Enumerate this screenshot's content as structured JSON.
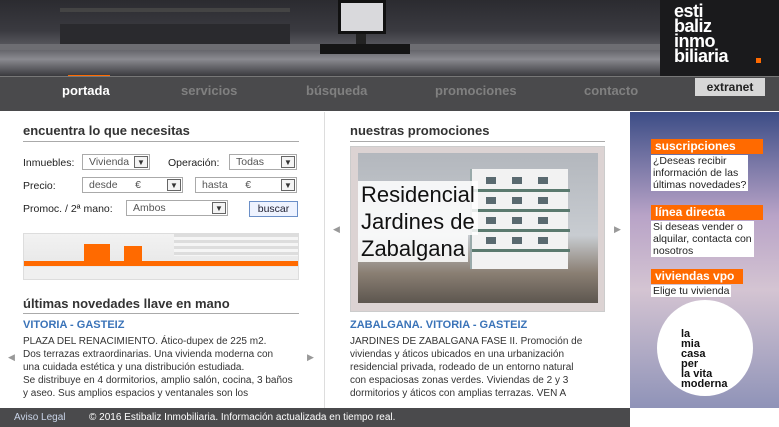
{
  "brand": {
    "lines": [
      "esti",
      "baliz",
      "inmo",
      "biliaria"
    ]
  },
  "nav": {
    "items": [
      {
        "label": "portada"
      },
      {
        "label": "servicios"
      },
      {
        "label": "búsqueda"
      },
      {
        "label": "promociones"
      },
      {
        "label": "contacto"
      }
    ],
    "extranet": "extranet"
  },
  "search": {
    "title": "encuentra lo que necesitas",
    "inmuebles_label": "Inmuebles:",
    "inmuebles_value": "Vivienda",
    "operacion_label": "Operación:",
    "operacion_value": "Todas",
    "precio_label": "Precio:",
    "desde_value": "desde      €",
    "hasta_value": "hasta      €",
    "promoc_label": "Promoc. / 2ª mano:",
    "promoc_value": "Ambos",
    "buscar_label": "buscar"
  },
  "novedades": {
    "title": "últimas novedades llave en mano",
    "city": "VITORIA - GASTEIZ",
    "text_lines": [
      "PLAZA DEL RENACIMIENTO. Ático-dupex de 225 m2.",
      "Dos terrazas extraordinarias. Una vivienda moderna con",
      "una cuidada estética y una distribución estudiada.",
      "Se distribuye en 4 dormitorios, amplio salón, cocina, 3 baños",
      "y aseo. Sus amplios espacios y ventanales son los"
    ]
  },
  "promociones": {
    "title": "nuestras promociones",
    "image_text": [
      "Residencial",
      "Jardines de",
      "Zabalgana"
    ],
    "city": "ZABALGANA. VITORIA - GASTEIZ",
    "text_lines": [
      "JARDINES DE ZABALGANA FASE II. Promoción de",
      "viviendas y áticos ubicados en una urbanización",
      "residencial privada, rodeado de un entorno natural",
      "con espaciosas zonas verdes. Viviendas de 2 y 3",
      "dormitorios y áticos  con amplias terrazas. VEN A"
    ]
  },
  "sidebar": {
    "suscripciones": {
      "title": "suscripciones",
      "lines": [
        "¿Deseas recibir",
        "información de las",
        "últimas novedades?"
      ]
    },
    "linea": {
      "title": "línea directa",
      "lines": [
        "Si deseas vender o",
        "alquilar, contacta con",
        "nosotros"
      ]
    },
    "vpo": {
      "title": "viviendas vpo",
      "lines": [
        "Elige tu vivienda"
      ]
    },
    "circle_lines": [
      "la",
      "mia",
      "casa",
      "per",
      "la vita",
      "moderna"
    ]
  },
  "footer": {
    "aviso": "Aviso Legal",
    "copyright": "© 2016 Estibaliz Inmobiliaria. Información actualizada en tiempo real."
  },
  "colors": {
    "accent": "#ff6a00",
    "link": "#3a73b8",
    "nav_bg": "#4a4a4c"
  }
}
